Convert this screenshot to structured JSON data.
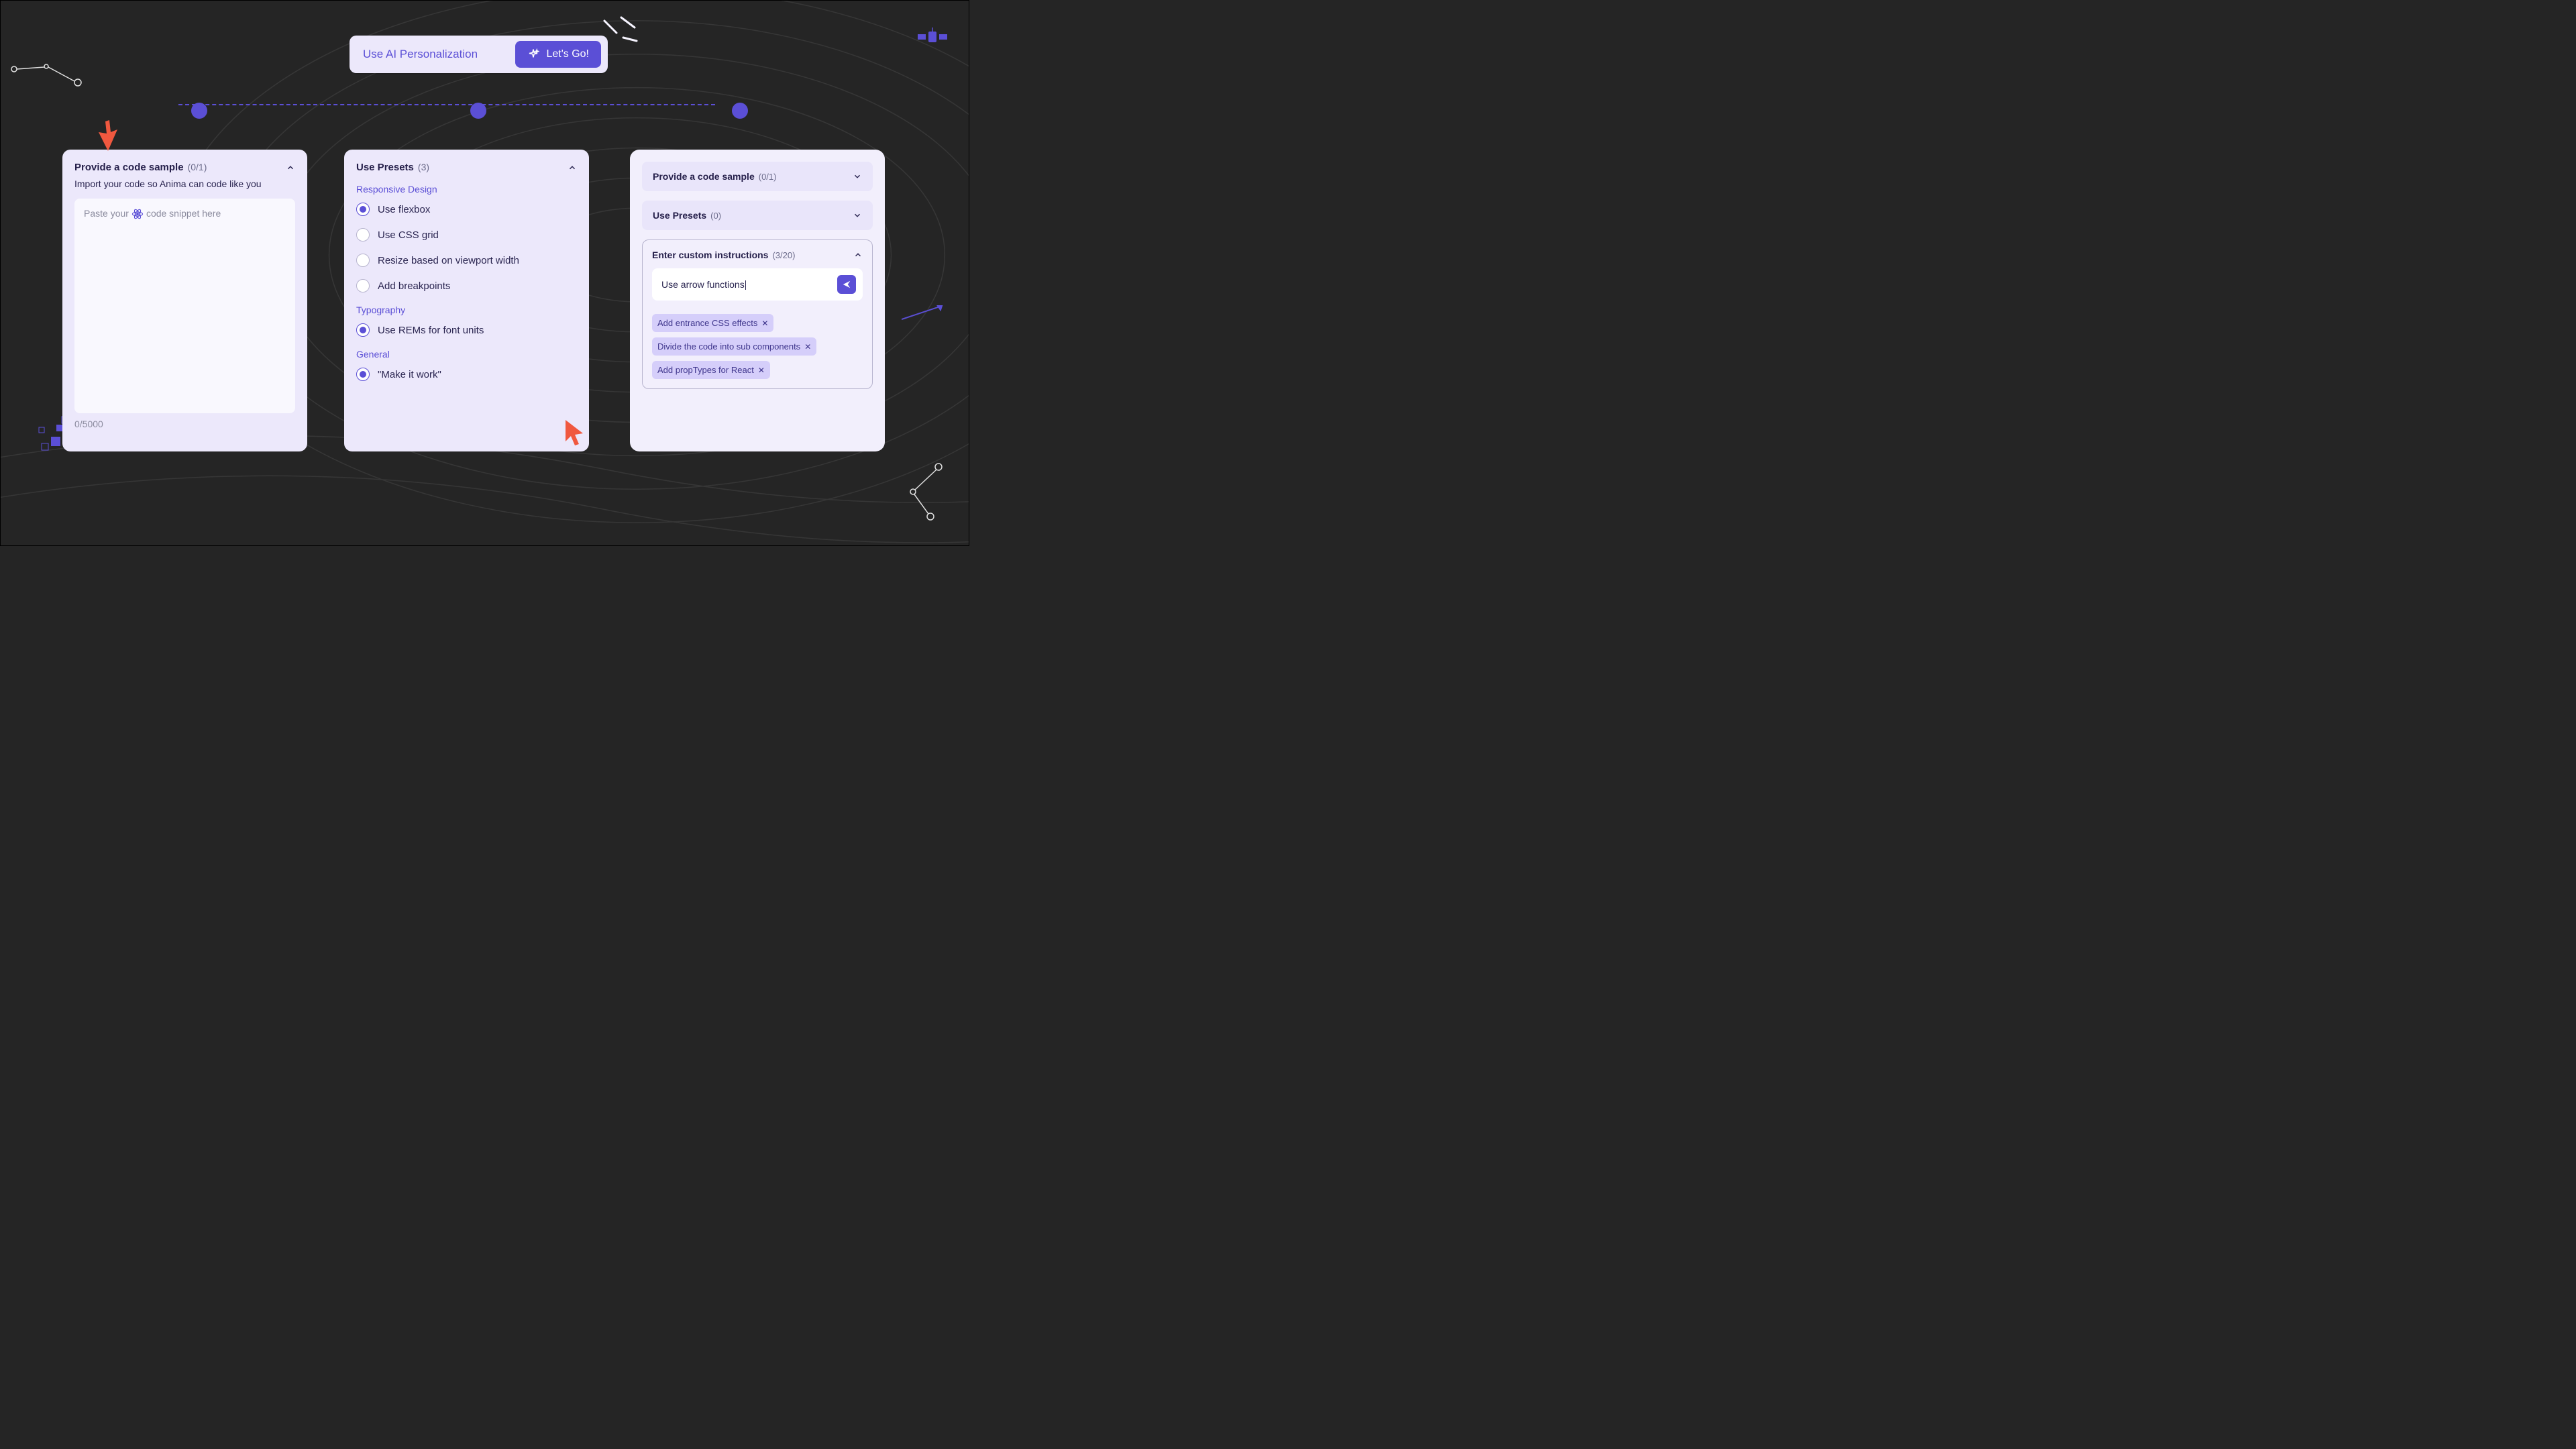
{
  "header": {
    "title": "Use AI Personalization",
    "button_label": "Let's Go!"
  },
  "card1": {
    "title": "Provide a code sample",
    "count": "(0/1)",
    "subtitle": "Import your code so Anima can code like you",
    "placeholder_pre": "Paste your",
    "placeholder_post": "code snippet here",
    "counter": "0/5000",
    "framework_icon": "react"
  },
  "card2": {
    "title": "Use Presets",
    "count": "(3)",
    "sections": {
      "responsive": {
        "label": "Responsive Design",
        "items": [
          {
            "label": "Use flexbox",
            "selected": true
          },
          {
            "label": "Use CSS grid",
            "selected": false
          },
          {
            "label": "Resize based on viewport width",
            "selected": false
          },
          {
            "label": "Add breakpoints",
            "selected": false
          }
        ]
      },
      "typography": {
        "label": "Typography",
        "items": [
          {
            "label": "Use REMs for font units",
            "selected": true
          }
        ]
      },
      "general": {
        "label": "General",
        "items": [
          {
            "label": "\"Make it work\"",
            "selected": true
          }
        ]
      }
    }
  },
  "card3": {
    "rows": {
      "code_sample": {
        "title": "Provide a code sample",
        "count": "(0/1)"
      },
      "presets": {
        "title": "Use Presets",
        "count": "(0)"
      }
    },
    "custom": {
      "title": "Enter custom instructions",
      "count": "(3/20)",
      "input_value": "Use arrow functions",
      "chips": [
        "Add entrance CSS effects",
        "Divide the code into sub components",
        "Add propTypes for React"
      ]
    }
  },
  "colors": {
    "accent": "#5B4FD6",
    "card_bg": "#ECE8FB",
    "arrow": "#F0583F"
  }
}
